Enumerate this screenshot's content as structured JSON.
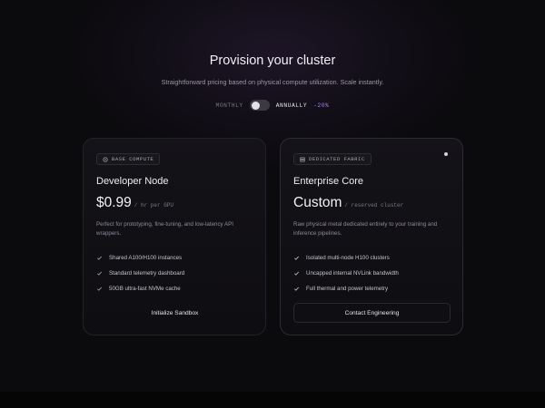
{
  "header": {
    "title": "Provision your cluster",
    "subtitle": "Straightforward pricing based on physical compute utilization. Scale instantly."
  },
  "billing": {
    "monthly_label": "MONTHLY",
    "annually_label": "ANNUALLY",
    "discount_label": "-20%",
    "selected": "monthly"
  },
  "plans": [
    {
      "tag": "BASE COMPUTE",
      "tag_icon": "chip-icon",
      "name": "Developer Node",
      "price": "$0.99",
      "unit": "/ hr per GPU",
      "description": "Perfect for prototyping, fine-tuning, and low-latency API wrappers.",
      "features": [
        "Shared A100/H100 instances",
        "Standard telemetry dashboard",
        "50GB ultra-fast NVMe cache"
      ],
      "cta": "Initialize Sandbox"
    },
    {
      "tag": "DEDICATED FABRIC",
      "tag_icon": "server-icon",
      "name": "Enterprise Core",
      "price": "Custom",
      "unit": "/ reserved cluster",
      "description": "Raw physical metal dedicated entirely to your training and inference pipelines.",
      "features": [
        "Isolated multi-node H100 clusters",
        "Uncapped internal NVLink bandwidth",
        "Full thermal and power telemetry"
      ],
      "cta": "Contact Engineering"
    }
  ],
  "colors": {
    "background": "#0b0a0d",
    "accent": "#a983e8",
    "card": "#141318"
  }
}
